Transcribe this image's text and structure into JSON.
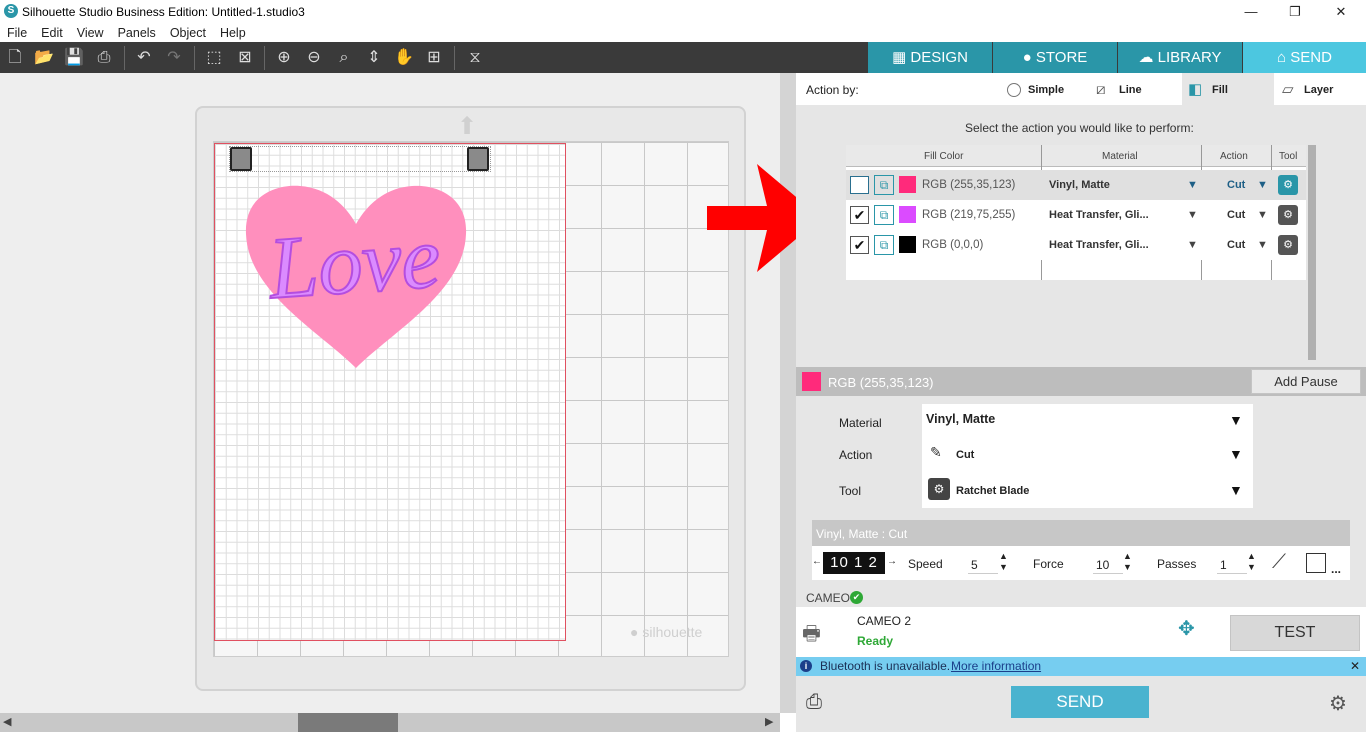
{
  "window": {
    "title": "Silhouette Studio Business Edition: Untitled-1.studio3",
    "min": "—",
    "max": "❐",
    "close": "✕"
  },
  "menu": [
    "File",
    "Edit",
    "View",
    "Panels",
    "Object",
    "Help"
  ],
  "tabs": [
    {
      "label": "DESIGN",
      "icon": "grid-icon"
    },
    {
      "label": "STORE",
      "icon": "s-logo-icon"
    },
    {
      "label": "LIBRARY",
      "icon": "cloud-icon"
    },
    {
      "label": "SEND",
      "icon": "cutter-icon"
    }
  ],
  "action_by": {
    "label": "Action by:",
    "options": [
      "Simple",
      "Line",
      "Fill",
      "Layer"
    ],
    "selected": "Fill"
  },
  "instruction": "Select the action you would like to perform:",
  "table": {
    "headers": [
      "Fill Color",
      "Material",
      "Action",
      "Tool"
    ],
    "rows": [
      {
        "checked": false,
        "color": "#ff2a7b",
        "label": "RGB (255,35,123)",
        "material": "Vinyl, Matte",
        "action": "Cut"
      },
      {
        "checked": true,
        "color": "#db4bff",
        "label": "RGB (219,75,255)",
        "material": "Heat Transfer, Gli...",
        "action": "Cut"
      },
      {
        "checked": true,
        "color": "#000000",
        "label": "RGB (0,0,0)",
        "material": "Heat Transfer, Gli...",
        "action": "Cut"
      }
    ]
  },
  "selected_color": {
    "color": "#ff2a7b",
    "label": "RGB (255,35,123)"
  },
  "add_pause": "Add Pause",
  "props": {
    "material_label": "Material",
    "material": "Vinyl, Matte",
    "action_label": "Action",
    "action": "Cut",
    "tool_label": "Tool",
    "tool": "Ratchet Blade"
  },
  "settings": {
    "title": "Vinyl, Matte : Cut",
    "blade_digits": "10 1 2",
    "speed_label": "Speed",
    "speed": "5",
    "force_label": "Force",
    "force": "10",
    "passes_label": "Passes",
    "passes": "1",
    "more": "..."
  },
  "device": {
    "section": "CAMEO",
    "name": "CAMEO 2",
    "status": "Ready",
    "test": "TEST"
  },
  "bluetooth": {
    "message": "Bluetooth is unavailable.",
    "link": "More information",
    "close": "✕"
  },
  "send": "SEND",
  "canvas": {
    "design_text": "Love",
    "heart_color": "#ff8fbd",
    "text_color": "#db8bff",
    "watermark": "silhouette"
  },
  "colors": {
    "accent": "#4cc7e0",
    "tab": "#2a96a8",
    "arrow": "#ff0000"
  }
}
